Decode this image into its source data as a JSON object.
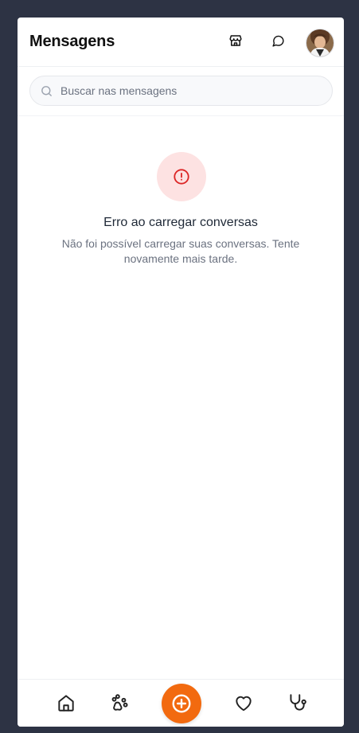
{
  "header": {
    "title": "Mensagens",
    "icons": [
      "store-icon",
      "chat-bubble-icon"
    ],
    "avatar_icon": "user-avatar"
  },
  "search": {
    "placeholder": "Buscar nas mensagens",
    "value": "",
    "icon": "search-icon"
  },
  "error": {
    "icon": "alert-circle-icon",
    "title": "Erro ao carregar conversas",
    "message": "Não foi possível carregar suas conversas. Tente novamente mais tarde.",
    "accent_color": "#dc2626",
    "background_color": "#fde2e2"
  },
  "bottom_nav": {
    "items": [
      {
        "icon": "home-icon"
      },
      {
        "icon": "paw-icon"
      },
      {
        "icon": "plus-circle-icon",
        "accent_color": "#f26a0f"
      },
      {
        "icon": "heart-icon"
      },
      {
        "icon": "stethoscope-icon"
      }
    ]
  },
  "colors": {
    "background": "#2d3344",
    "surface": "#ffffff",
    "accent": "#f26a0f"
  }
}
